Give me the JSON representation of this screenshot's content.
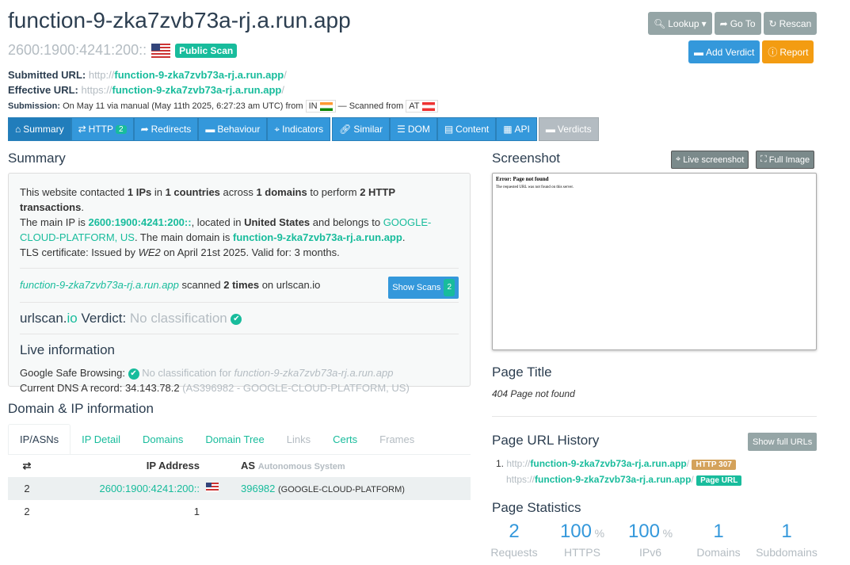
{
  "header": {
    "title": "function-9-zka7zvb73a-rj.a.run.app",
    "ip": "2600:1900:4241:200::",
    "public_scan": "Public Scan",
    "submitted_label": "Submitted URL:",
    "submitted_scheme": "http://",
    "submitted_host": "function-9-zka7zvb73a-rj.a.run.app",
    "submitted_tail": "/",
    "effective_label": "Effective URL:",
    "effective_scheme": "https://",
    "effective_host": "function-9-zka7zvb73a-rj.a.run.app",
    "effective_tail": "/",
    "submission_label": "Submission:",
    "submission_text": "On May 11 via manual (May 11th 2025, 6:27:23 am UTC) from",
    "from_cc": "IN",
    "scanned_from_label": "— Scanned from",
    "scanned_cc": "AT"
  },
  "actions": {
    "lookup": "Lookup",
    "goto": "Go To",
    "rescan": "Rescan",
    "add_verdict": "Add Verdict",
    "report": "Report"
  },
  "tabs": [
    {
      "label": "Summary"
    },
    {
      "label": "HTTP",
      "count": "2"
    },
    {
      "label": "Redirects"
    },
    {
      "label": "Behaviour"
    },
    {
      "label": "Indicators"
    },
    {
      "label": "Similar"
    },
    {
      "label": "DOM"
    },
    {
      "label": "Content"
    },
    {
      "label": "API"
    },
    {
      "label": "Verdicts"
    }
  ],
  "summary": {
    "heading": "Summary",
    "s1a": "This website contacted ",
    "ips": "1 IPs",
    "s1b": " in ",
    "countries": "1 countries",
    "s1c": " across ",
    "domains": "1 domains",
    "s1d": " to perform ",
    "transactions": "2 HTTP transactions",
    "s1e": ".",
    "s2a": "The main IP is ",
    "main_ip": "2600:1900:4241:200::",
    "s2b": ", located in ",
    "country": "United States",
    "s2c": " and belongs to ",
    "asn_name": "GOOGLE-CLOUD-PLATFORM, US",
    "s2d": ". The main domain is ",
    "main_domain": "function-9-zka7zvb73a-rj.a.run.app",
    "s2e": ".",
    "tls_a": "TLS certificate: Issued by ",
    "issuer": "WE2",
    "tls_b": " on April 21st 2025. Valid for: 3 months.",
    "scanned_domain": "function-9-zka7zvb73a-rj.a.run.app",
    "scanned_a": " scanned ",
    "scanned_times": "2 times",
    "scanned_b": " on urlscan.io",
    "show_scans": "Show Scans",
    "show_scans_count": "2",
    "verdict_brand_a": "urlscan.",
    "verdict_brand_b": "io",
    "verdict_label": " Verdict: ",
    "verdict_value": "No classification",
    "live_heading": "Live information",
    "gsb_label": "Google Safe Browsing: ",
    "gsb_value": "No classification for ",
    "gsb_domain": "function-9-zka7zvb73a-rj.a.run.app",
    "dns_label": "Current DNS A record: ",
    "dns_ip": "34.143.78.2",
    "dns_asn": " (AS396982 - GOOGLE-CLOUD-PLATFORM, US)"
  },
  "domain_ip": {
    "heading": "Domain & IP information",
    "subtabs": [
      "IP/ASNs",
      "IP Detail",
      "Domains",
      "Domain Tree",
      "Links",
      "Certs",
      "Frames"
    ],
    "col_ip": "IP Address",
    "col_as": "AS",
    "col_as_sub": "Autonomous System",
    "rows": [
      {
        "count": "2",
        "ip": "2600:1900:4241:200::",
        "asn": "396982",
        "asname": "(GOOGLE-CLOUD-PLATFORM)"
      }
    ],
    "total_count": "2",
    "total_ips": "1"
  },
  "screenshot": {
    "heading": "Screenshot",
    "live_btn": "Live screenshot",
    "full_btn": "Full Image",
    "error_title": "Error: Page not found",
    "error_text": "The requested URL was not found on this server."
  },
  "page_title": {
    "heading": "Page Title",
    "value": "404 Page not found"
  },
  "url_history": {
    "heading": "Page URL History",
    "show_full": "Show full URLs",
    "item1_scheme": "http://",
    "item1_host": "function-9-zka7zvb73a-rj.a.run.app",
    "item1_tail": "/",
    "item1_badge": "HTTP 307",
    "item2_scheme": "https://",
    "item2_host": "function-9-zka7zvb73a-rj.a.run.app",
    "item2_tail": "/",
    "item2_badge": "Page URL"
  },
  "stats": {
    "heading": "Page Statistics",
    "items": [
      {
        "value": "2",
        "unit": "",
        "label": "Requests"
      },
      {
        "value": "100",
        "unit": "%",
        "label": "HTTPS"
      },
      {
        "value": "100",
        "unit": "%",
        "label": "IPv6"
      },
      {
        "value": "1",
        "unit": "",
        "label": "Domains"
      },
      {
        "value": "1",
        "unit": "",
        "label": "Subdomains"
      }
    ]
  },
  "colors": {
    "accent_green": "#18bc9c",
    "primary_blue": "#3498db",
    "orange": "#f39c12",
    "dark": "#2c3e50"
  }
}
